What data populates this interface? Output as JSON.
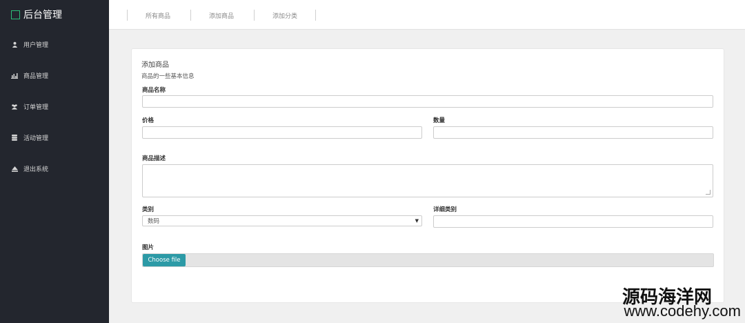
{
  "sidebar": {
    "brand": "后台管理",
    "items": [
      {
        "label": "用户管理",
        "icon": "user-icon"
      },
      {
        "label": "商品管理",
        "icon": "bar-chart-icon"
      },
      {
        "label": "订单管理",
        "icon": "users-icon"
      },
      {
        "label": "活动管理",
        "icon": "database-icon"
      },
      {
        "label": "退出系统",
        "icon": "eject-icon"
      }
    ]
  },
  "topbar": {
    "tabs": [
      {
        "label": "所有商品"
      },
      {
        "label": "添加商品"
      },
      {
        "label": "添加分类"
      }
    ]
  },
  "form": {
    "title": "添加商品",
    "subtitle": "商品的一些基本信息",
    "name_label": "商品名称",
    "price_label": "价格",
    "quantity_label": "数量",
    "desc_label": "商品描述",
    "category_label": "类别",
    "category_value": "数码",
    "detail_category_label": "详细类别",
    "image_label": "图片",
    "choose_file_label": "Choose file"
  },
  "watermark": {
    "line1": "源码海洋网",
    "line2": "www.codehy.com"
  }
}
